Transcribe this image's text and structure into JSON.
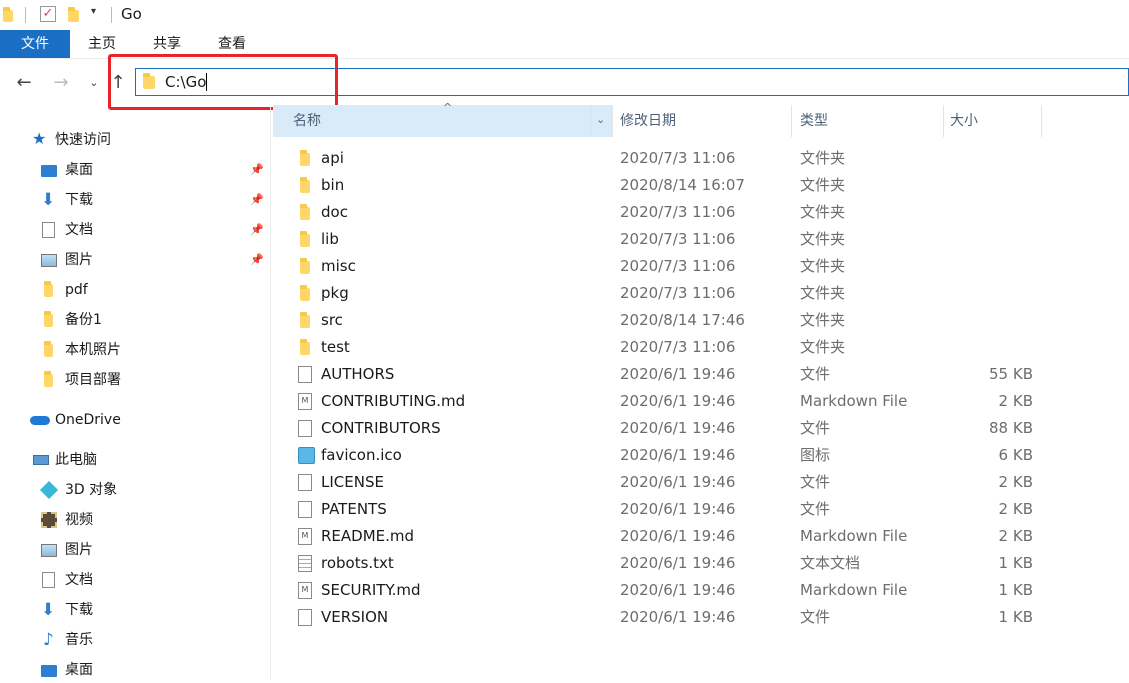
{
  "window": {
    "title": "Go"
  },
  "ribbon": {
    "tabs": [
      "文件",
      "主页",
      "共享",
      "查看"
    ]
  },
  "address": {
    "path": "C:\\Go"
  },
  "sidebar": {
    "quick_access": "快速访问",
    "pinned": [
      "桌面",
      "下载",
      "文档",
      "图片"
    ],
    "folders": [
      "pdf",
      "备份1",
      "本机照片",
      "项目部署"
    ],
    "onedrive": "OneDrive",
    "this_pc": "此电脑",
    "pc_items": [
      "3D 对象",
      "视频",
      "图片",
      "文档",
      "下载",
      "音乐",
      "桌面"
    ]
  },
  "columns": {
    "name": "名称",
    "date": "修改日期",
    "type": "类型",
    "size": "大小"
  },
  "files": [
    {
      "name": "api",
      "date": "2020/7/3 11:06",
      "type": "文件夹",
      "size": "",
      "icon": "folder-icon"
    },
    {
      "name": "bin",
      "date": "2020/8/14 16:07",
      "type": "文件夹",
      "size": "",
      "icon": "folder-icon"
    },
    {
      "name": "doc",
      "date": "2020/7/3 11:06",
      "type": "文件夹",
      "size": "",
      "icon": "folder-icon"
    },
    {
      "name": "lib",
      "date": "2020/7/3 11:06",
      "type": "文件夹",
      "size": "",
      "icon": "folder-icon"
    },
    {
      "name": "misc",
      "date": "2020/7/3 11:06",
      "type": "文件夹",
      "size": "",
      "icon": "folder-icon"
    },
    {
      "name": "pkg",
      "date": "2020/7/3 11:06",
      "type": "文件夹",
      "size": "",
      "icon": "folder-icon"
    },
    {
      "name": "src",
      "date": "2020/8/14 17:46",
      "type": "文件夹",
      "size": "",
      "icon": "folder-icon"
    },
    {
      "name": "test",
      "date": "2020/7/3 11:06",
      "type": "文件夹",
      "size": "",
      "icon": "folder-icon"
    },
    {
      "name": "AUTHORS",
      "date": "2020/6/1 19:46",
      "type": "文件",
      "size": "55 KB",
      "icon": "file-icon"
    },
    {
      "name": "CONTRIBUTING.md",
      "date": "2020/6/1 19:46",
      "type": "Markdown File",
      "size": "2 KB",
      "icon": "markdown-file-icon"
    },
    {
      "name": "CONTRIBUTORS",
      "date": "2020/6/1 19:46",
      "type": "文件",
      "size": "88 KB",
      "icon": "file-icon"
    },
    {
      "name": "favicon.ico",
      "date": "2020/6/1 19:46",
      "type": "图标",
      "size": "6 KB",
      "icon": "image-file-icon"
    },
    {
      "name": "LICENSE",
      "date": "2020/6/1 19:46",
      "type": "文件",
      "size": "2 KB",
      "icon": "file-icon"
    },
    {
      "name": "PATENTS",
      "date": "2020/6/1 19:46",
      "type": "文件",
      "size": "2 KB",
      "icon": "file-icon"
    },
    {
      "name": "README.md",
      "date": "2020/6/1 19:46",
      "type": "Markdown File",
      "size": "2 KB",
      "icon": "markdown-file-icon"
    },
    {
      "name": "robots.txt",
      "date": "2020/6/1 19:46",
      "type": "文本文档",
      "size": "1 KB",
      "icon": "text-file-icon"
    },
    {
      "name": "SECURITY.md",
      "date": "2020/6/1 19:46",
      "type": "Markdown File",
      "size": "1 KB",
      "icon": "markdown-file-icon"
    },
    {
      "name": "VERSION",
      "date": "2020/6/1 19:46",
      "type": "文件",
      "size": "1 KB",
      "icon": "file-icon"
    }
  ],
  "colors": {
    "accent": "#1a6fc4",
    "highlight_box": "#e8242b",
    "folder": "#ffd768",
    "header_selected": "#d9ebf9"
  }
}
